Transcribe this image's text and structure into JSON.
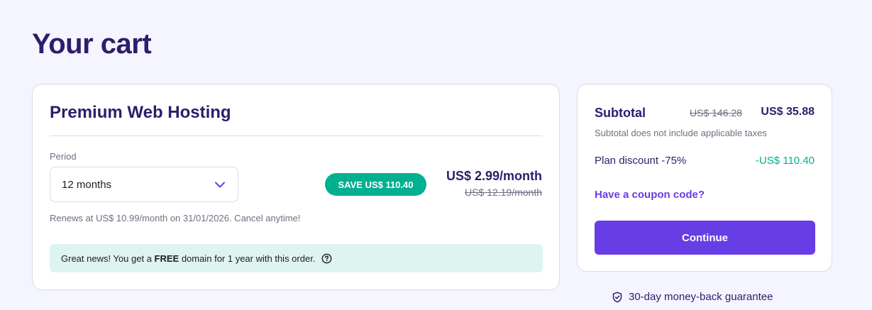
{
  "page": {
    "title": "Your cart"
  },
  "product": {
    "name": "Premium Web Hosting",
    "period_label": "Period",
    "period_value": "12 months",
    "save_badge": "SAVE US$ 110.40",
    "price": "US$ 2.99/month",
    "old_price": "US$ 12.19/month",
    "renewal_note": "Renews at US$ 10.99/month on 31/01/2026. Cancel anytime!",
    "promo": {
      "prefix": "Great news! You get a ",
      "highlight": "FREE",
      "suffix": " domain for 1 year with this order."
    }
  },
  "summary": {
    "subtotal_label": "Subtotal",
    "subtotal_old": "US$ 146.28",
    "subtotal_new": "US$ 35.88",
    "tax_note": "Subtotal does not include applicable taxes",
    "discount_label": "Plan discount -75%",
    "discount_value": "-US$ 110.40",
    "coupon_link": "Have a coupon code?",
    "continue_label": "Continue"
  },
  "guarantee": {
    "text": "30-day money-back guarantee"
  },
  "icons": {
    "period_select": "chevron-down-icon",
    "promo": "help-circle-icon",
    "guarantee": "shield-check-icon"
  },
  "colors": {
    "background": "#f4f5ff",
    "heading": "#2f1c6a",
    "accent": "#673de6",
    "success": "#00b090",
    "promo_bg": "#def4f0"
  }
}
